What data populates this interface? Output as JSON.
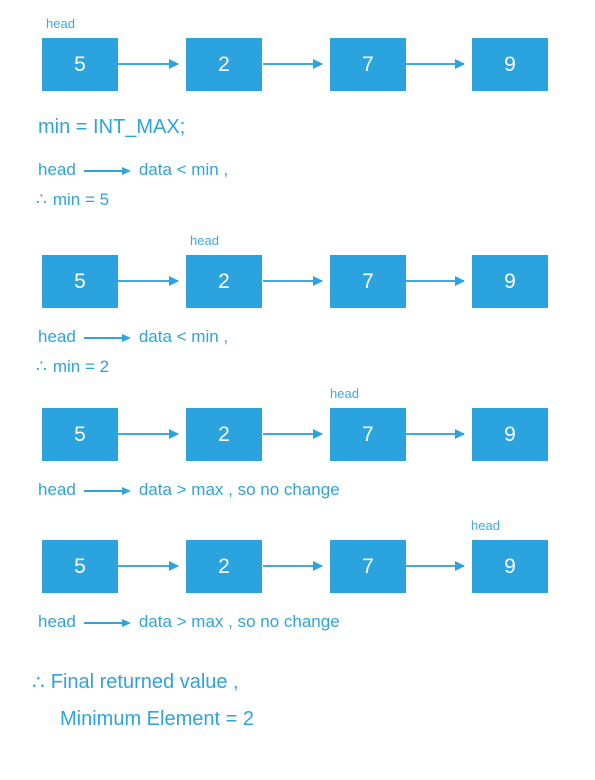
{
  "colors": {
    "node_fill": "#2BA3DE",
    "node_text": "#FFFFFF",
    "body_text": "#2FA3DD",
    "arrow": "#41A9DF",
    "background": "#FFFFFF"
  },
  "list_values": [
    "5",
    "2",
    "7",
    "9"
  ],
  "head_label": "head",
  "steps": [
    {
      "id": "step-1",
      "head_index": 0,
      "nodes": [
        "5",
        "2",
        "7",
        "9"
      ],
      "lines": [
        "min  =  INT_MAX;",
        "head",
        "data  <  min ,",
        "min  =  5"
      ]
    },
    {
      "id": "step-2",
      "head_index": 1,
      "nodes": [
        "5",
        "2",
        "7",
        "9"
      ],
      "lines": [
        "head",
        "data  <  min ,",
        "min  =  2"
      ]
    },
    {
      "id": "step-3",
      "head_index": 2,
      "nodes": [
        "5",
        "2",
        "7",
        "9"
      ],
      "lines": [
        "head",
        "data  >  max , so no change"
      ]
    },
    {
      "id": "step-4",
      "head_index": 3,
      "nodes": [
        "5",
        "2",
        "7",
        "9"
      ],
      "lines": [
        "head",
        "data  >  max , so no change"
      ]
    }
  ],
  "text": {
    "min_init": "min  =  INT_MAX;",
    "head_word": "head",
    "cond_lt": "data  <  min ,",
    "cond_gt": "data  >  max , so no change",
    "therefore_symbol": "∴",
    "min_is_5": "min  =  5",
    "min_is_2": "min  =  2",
    "final_line_1": "Final returned value ,",
    "final_line_2": "Minimum Element  =  2"
  }
}
